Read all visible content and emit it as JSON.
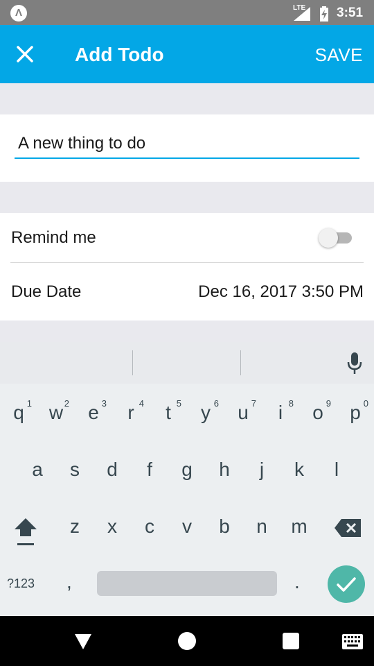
{
  "status_bar": {
    "app_badge": "Λ",
    "network": "LTE",
    "time": "3:51",
    "icons": [
      "app-notification-icon",
      "signal-icon",
      "battery-icon"
    ]
  },
  "app_bar": {
    "title": "Add Todo",
    "save_label": "SAVE",
    "close_icon": "close-icon",
    "color": "#03a7e6"
  },
  "todo": {
    "text": "A new thing to do"
  },
  "options": {
    "remind_label": "Remind me",
    "remind_on": false,
    "due_label": "Due Date",
    "due_value": "Dec 16, 2017 3:50 PM"
  },
  "keyboard": {
    "row1": [
      {
        "key": "q",
        "hint": "1"
      },
      {
        "key": "w",
        "hint": "2"
      },
      {
        "key": "e",
        "hint": "3"
      },
      {
        "key": "r",
        "hint": "4"
      },
      {
        "key": "t",
        "hint": "5"
      },
      {
        "key": "y",
        "hint": "6"
      },
      {
        "key": "u",
        "hint": "7"
      },
      {
        "key": "i",
        "hint": "8"
      },
      {
        "key": "o",
        "hint": "9"
      },
      {
        "key": "p",
        "hint": "0"
      }
    ],
    "row2": [
      "a",
      "s",
      "d",
      "f",
      "g",
      "h",
      "j",
      "k",
      "l"
    ],
    "row3": [
      "z",
      "x",
      "c",
      "v",
      "b",
      "n",
      "m"
    ],
    "symbols_label": "?123",
    "comma": ",",
    "period": ".",
    "enter_color": "#4fb7a8"
  },
  "nav_bar": {
    "icons": [
      "back-icon",
      "home-icon",
      "recents-icon",
      "keyboard-switch-icon"
    ]
  }
}
